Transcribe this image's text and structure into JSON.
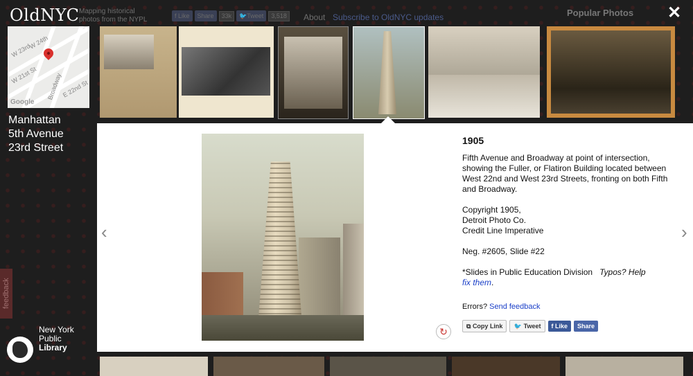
{
  "header": {
    "logo": "OldNYC",
    "tagline": "Mapping historical photos from the NYPL",
    "like_label": "Like",
    "share_label": "Share",
    "like_count": "33k",
    "tweet_label": "Tweet",
    "tweet_count": "3,518",
    "about_label": "About",
    "subscribe_label": "Subscribe to OldNYC updates",
    "popular_label": "Popular Photos",
    "close_label": "✕"
  },
  "map": {
    "streets": [
      "W 24th",
      "W 21st St",
      "Broadway",
      "E 22nd St",
      "W 23rd"
    ],
    "attribution": "Google"
  },
  "location": {
    "line1": "Manhattan",
    "line2": "5th Avenue",
    "line3": "23rd Street"
  },
  "feedback_tab": "feedback",
  "nypl": {
    "line1": "New York",
    "line2": "Public",
    "line3": "Library"
  },
  "photo_info": {
    "year": "1905",
    "description": "Fifth Avenue and Broadway at point of intersection, showing the Fuller, or Flatiron Building located between West 22nd and West 23rd Streets, fronting on both Fifth and Broadway.",
    "copyright_line1": "Copyright 1905,",
    "copyright_line2": "Detroit Photo Co.",
    "copyright_line3": "Credit Line Imperative",
    "negative": "Neg. #2605, Slide #22",
    "slides_note": "*Slides in Public Education Division",
    "typos_label": "Typos? Help",
    "fix_link": "fix them",
    "fix_suffix": ".",
    "errors_label": "Errors?",
    "send_feedback": "Send feedback"
  },
  "share": {
    "copy_link": "Copy Link",
    "tweet": "Tweet",
    "like": "Like",
    "share": "Share"
  },
  "nav": {
    "prev": "‹",
    "next": "›"
  }
}
